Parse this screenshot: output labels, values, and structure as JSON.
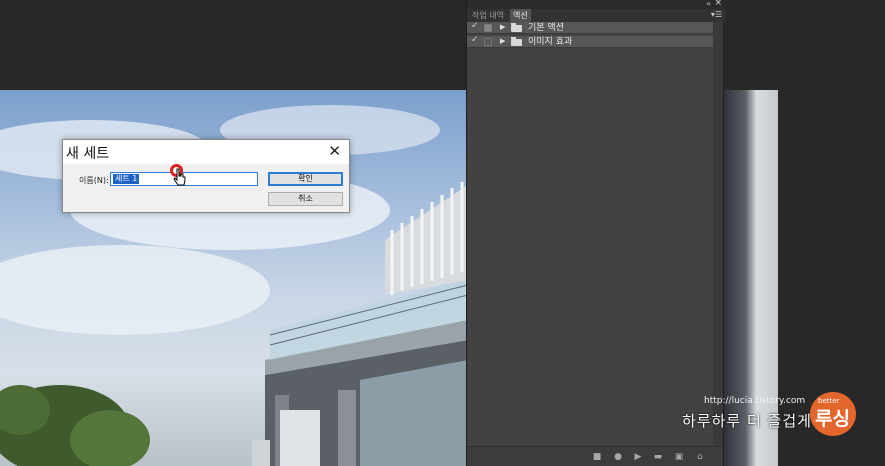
{
  "panel": {
    "tabs": [
      "작업 내역",
      "액션"
    ],
    "active_tab": "액션",
    "menu_icon": "panel-menu-icon",
    "collapse_icon": "«",
    "close_icon": "×",
    "rows": [
      {
        "checked": "✓",
        "label": "기본 액션"
      },
      {
        "checked": "✓",
        "label": "이미지 효과"
      }
    ],
    "bottom_icons": [
      "stop-icon",
      "record-icon",
      "play-icon",
      "new-set-icon",
      "new-action-icon",
      "delete-icon"
    ]
  },
  "dialog": {
    "title": "새 세트",
    "close_glyph": "✕",
    "name_label": "이름(N):",
    "name_value": "세트 1",
    "ok_label": "확인",
    "cancel_label": "취소"
  },
  "watermark": {
    "url": "http://lucia.tistory.com",
    "tagline": "하루하루 더 즐겁게",
    "logo_small": "better",
    "logo_text": "루싱",
    "accent": "#e3662c"
  },
  "colors": {
    "panel_bg": "#424242",
    "selection": "#1d63c6",
    "focus_border": "#2c7dd1"
  }
}
